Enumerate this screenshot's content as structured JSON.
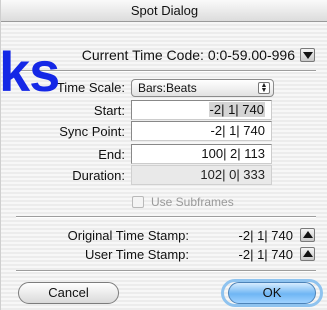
{
  "window": {
    "title": "Spot Dialog"
  },
  "watermark": {
    "text": "ks"
  },
  "time_code": {
    "label": "Current Time Code:",
    "value": "0:0-59.00-996"
  },
  "time_scale": {
    "label": "Time Scale:",
    "selected": "Bars:Beats"
  },
  "fields": {
    "start": {
      "label": "Start:",
      "value": "-2| 1| 740"
    },
    "sync_point": {
      "label": "Sync Point:",
      "value": "-2| 1| 740"
    },
    "end": {
      "label": "End:",
      "value": "100| 2| 113"
    },
    "duration": {
      "label": "Duration:",
      "value": "102| 0| 333"
    }
  },
  "use_subframes": {
    "label": "Use Subframes",
    "checked": false,
    "enabled": false
  },
  "stamps": {
    "original": {
      "label": "Original Time Stamp:",
      "value": "-2| 1| 740"
    },
    "user": {
      "label": "User Time Stamp:",
      "value": "-2| 1| 740"
    }
  },
  "buttons": {
    "cancel": "Cancel",
    "ok": "OK"
  },
  "colors": {
    "watermark": "#1427e6",
    "ok_button": "#6fb6f4"
  }
}
